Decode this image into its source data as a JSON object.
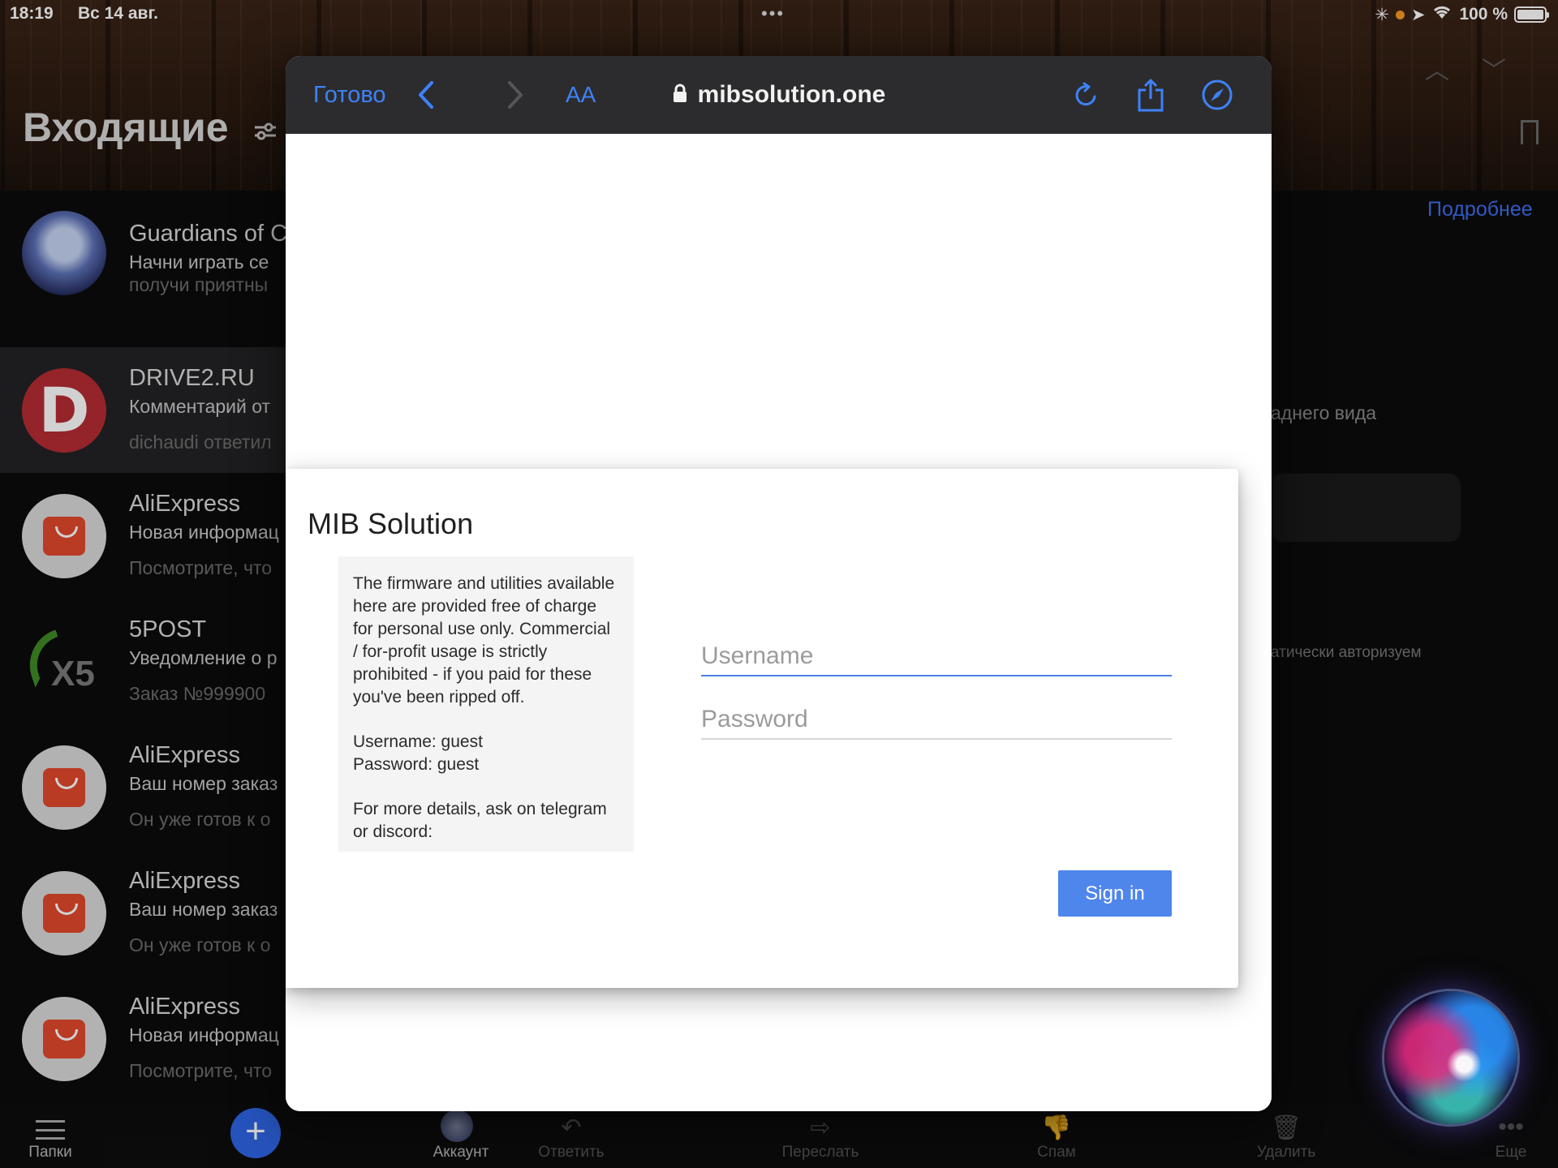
{
  "status_bar": {
    "time": "18:19",
    "date": "Вс 14 авг.",
    "battery": "100 %",
    "battery_level": 1.0
  },
  "inbox": {
    "title": "Входящие",
    "mails": [
      {
        "sender": "Guardians of C",
        "subject": "Начни играть се",
        "preview": "получи приятны",
        "avatar": "anime-avatar"
      },
      {
        "sender": "DRIVE2.RU",
        "subject": "Комментарий от",
        "preview": "dichaudi ответил",
        "avatar": "drive2-logo",
        "avatar_letter": "D"
      },
      {
        "sender": "AliExpress",
        "subject": "Новая информац",
        "preview": "Посмотрите, что",
        "avatar": "aliexpress-logo"
      },
      {
        "sender": "5POST",
        "subject": "Уведомление о р",
        "preview": "Заказ №999900",
        "avatar": "x5-logo",
        "avatar_text": "X5"
      },
      {
        "sender": "AliExpress",
        "subject": "Ваш номер заказ",
        "preview": "Он уже готов к о",
        "avatar": "aliexpress-logo"
      },
      {
        "sender": "AliExpress",
        "subject": "Ваш номер заказ",
        "preview": "Он уже готов к о",
        "avatar": "aliexpress-logo"
      },
      {
        "sender": "AliExpress",
        "subject": "Новая информац",
        "preview": "Посмотрите, что",
        "avatar": "aliexpress-logo"
      }
    ]
  },
  "right_pane": {
    "more_link": "Подробнее",
    "text1": "аднего вида",
    "text2": "атически авторизуем"
  },
  "bottom_bar": {
    "folders": "Папки",
    "account": "Аккаунт",
    "reply": "Ответить",
    "forward": "Переслать",
    "spam": "Спам",
    "delete": "Удалить",
    "more": "Еще"
  },
  "safari": {
    "done": "Готово",
    "text_size": "AA",
    "url": "mibsolution.one",
    "accent": "#3e82f7"
  },
  "login": {
    "title": "MIB Solution",
    "info_lines": [
      "The firmware and utilities available here are provided free of charge for personal use only. Commercial / for-profit usage is strictly prohibited - if you paid for these you've been ripped off.",
      "Username: guest",
      "Password: guest",
      "For more details, ask on telegram or discord:"
    ],
    "username_placeholder": "Username",
    "password_placeholder": "Password",
    "signin_label": "Sign in",
    "button_color": "#4e86ec"
  }
}
